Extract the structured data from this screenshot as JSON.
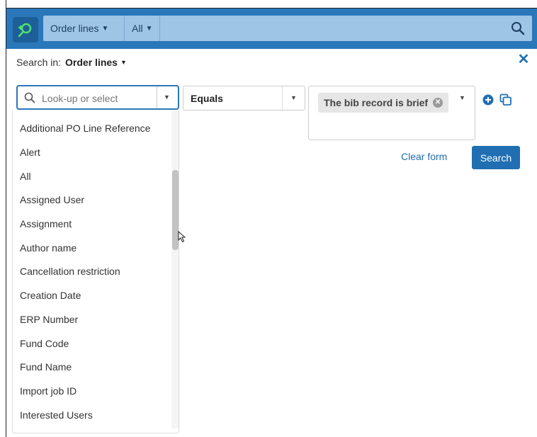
{
  "topbar": {
    "scope": "Order lines",
    "filter": "All",
    "colors": {
      "bar": "#2a77b9",
      "strip": "#9ec4e6",
      "logo": "#1d5f99",
      "accent": "#1f6fb2"
    },
    "icons": {
      "logo": "search-plus-logo-icon",
      "search": "search-icon"
    }
  },
  "search_in": {
    "label": "Search in:",
    "value": "Order lines"
  },
  "field": {
    "placeholder": "Look-up or select",
    "options": [
      "Additional PO Line Reference",
      "Alert",
      "All",
      "Assigned User",
      "Assignment",
      "Author name",
      "Cancellation restriction",
      "Creation Date",
      "ERP Number",
      "Fund Code",
      "Fund Name",
      "Import job ID",
      "Interested Users"
    ]
  },
  "operator": {
    "value": "Equals"
  },
  "value": {
    "chip": "The bib record is brief"
  },
  "actions": {
    "clear": "Clear form",
    "search": "Search"
  }
}
